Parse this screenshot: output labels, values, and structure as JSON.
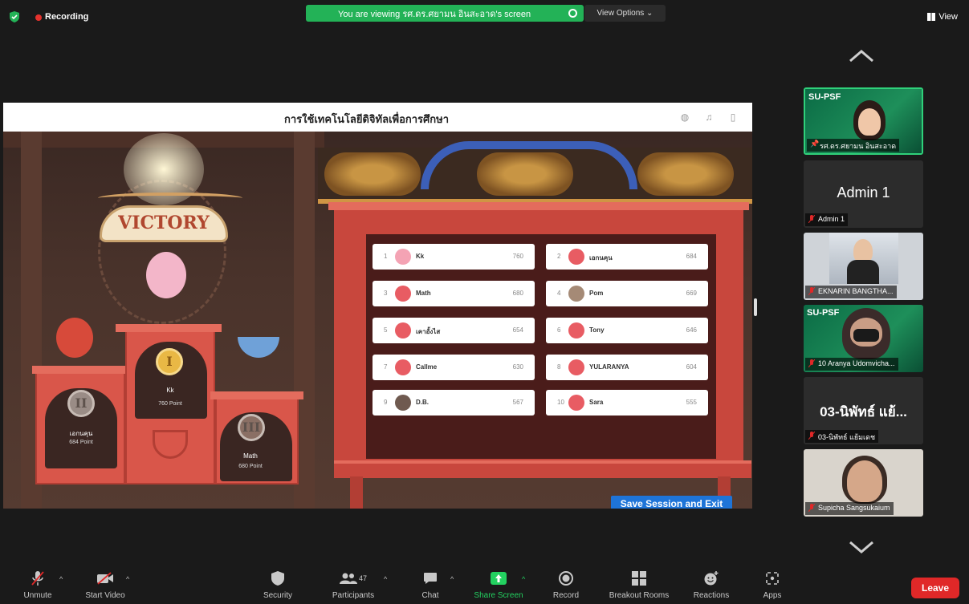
{
  "topbar": {
    "recording_label": "Recording",
    "viewing_banner": "You are viewing รศ.ดร.ศยามน อินสะอาด's screen",
    "view_options": "View Options ⌄",
    "view_label": "View"
  },
  "shared_screen": {
    "title": "การใช้เทคโนโลยีดิจิทัลเพื่อการศึกษา",
    "banner": "VICTORY",
    "podium": [
      {
        "place": "II",
        "name": "เอกนคุน",
        "points": "684 Point"
      },
      {
        "place": "I",
        "name": "Kk",
        "points": "760 Point"
      },
      {
        "place": "III",
        "name": "Math",
        "points": "680 Point"
      }
    ],
    "leaderboard": [
      {
        "rank": "1",
        "name": "Kk",
        "score": "760",
        "avatar_color": "#f4a3b4"
      },
      {
        "rank": "2",
        "name": "เอกนคุน",
        "score": "684",
        "avatar_color": "#e4545b"
      },
      {
        "rank": "3",
        "name": "Math",
        "score": "680",
        "avatar_color": "#e4545b"
      },
      {
        "rank": "4",
        "name": "Pom",
        "score": "669",
        "avatar_color": "#a58a76"
      },
      {
        "rank": "5",
        "name": "เคาอั้งไส",
        "score": "654",
        "avatar_color": "#e4545b"
      },
      {
        "rank": "6",
        "name": "Tony",
        "score": "646",
        "avatar_color": "#e4545b"
      },
      {
        "rank": "7",
        "name": "Callme",
        "score": "630",
        "avatar_color": "#e4545b"
      },
      {
        "rank": "8",
        "name": "YULARANYA",
        "score": "604",
        "avatar_color": "#e4545b"
      },
      {
        "rank": "9",
        "name": "D.B.",
        "score": "567",
        "avatar_color": "#6f5a50"
      },
      {
        "rank": "10",
        "name": "Sara",
        "score": "555",
        "avatar_color": "#e4545b"
      }
    ],
    "save_button": "Save Session and Exit"
  },
  "participants": [
    {
      "tag": "SU-PSF",
      "label": "รศ.ดร.ศยามน อินสะอาด",
      "pinned": true
    },
    {
      "big_name": "Admin 1",
      "label": "Admin 1"
    },
    {
      "label": "EKNARIN BANGTHA..."
    },
    {
      "tag": "SU-PSF",
      "label": "10 Aranya Udomvicha..."
    },
    {
      "big_name": "03-นิพัทธ์ แย้...",
      "label": "03-นิพัทธ์ แย้มเดช"
    },
    {
      "label": "Supicha Sangsukaium"
    }
  ],
  "toolbar": {
    "unmute": "Unmute",
    "start_video": "Start Video",
    "security": "Security",
    "participants": "Participants",
    "participants_count": "47",
    "chat": "Chat",
    "share_screen": "Share Screen",
    "record": "Record",
    "breakout_rooms": "Breakout Rooms",
    "reactions": "Reactions",
    "apps": "Apps",
    "leave": "Leave"
  },
  "colors": {
    "accent_green": "#23b257",
    "leave_red": "#e02828",
    "save_blue": "#1e74d8"
  }
}
